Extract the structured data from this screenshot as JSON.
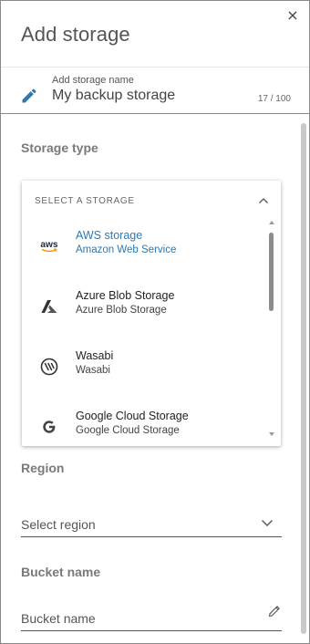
{
  "dialog": {
    "title": "Add storage",
    "close_label": "×"
  },
  "storage_name": {
    "caption": "Add storage name",
    "value": "My backup storage",
    "counter": "17 / 100"
  },
  "storage_type": {
    "label": "Storage type",
    "dropdown": {
      "header": "SELECT A STORAGE",
      "items": [
        {
          "name": "AWS storage",
          "subtitle": "Amazon Web Service",
          "icon": "aws-logo-icon",
          "selected": true
        },
        {
          "name": "Azure Blob Storage",
          "subtitle": "Azure Blob Storage",
          "icon": "azure-logo-icon",
          "selected": false
        },
        {
          "name": "Wasabi",
          "subtitle": "Wasabi",
          "icon": "wasabi-logo-icon",
          "selected": false
        },
        {
          "name": "Google Cloud Storage",
          "subtitle": "Google Cloud Storage",
          "icon": "google-logo-icon",
          "selected": false
        }
      ]
    }
  },
  "region": {
    "label": "Region",
    "placeholder": "Select region"
  },
  "bucket": {
    "label": "Bucket name",
    "placeholder": "Bucket name"
  },
  "colors": {
    "accent": "#2a7ab5",
    "aws_text": "#232f3e",
    "aws_smile": "#ff9900"
  }
}
